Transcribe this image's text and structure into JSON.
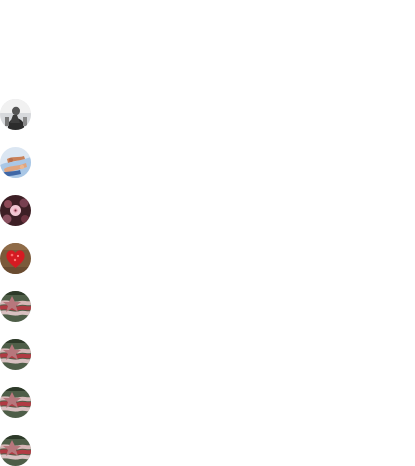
{
  "avatars": [
    {
      "label": "avatar-photo-dark-figure",
      "picture": "dark-figure"
    },
    {
      "label": "avatar-photo-hands",
      "picture": "hands"
    },
    {
      "label": "avatar-photo-pink-flower",
      "picture": "pink-flower"
    },
    {
      "label": "avatar-photo-red-heart",
      "picture": "red-heart"
    },
    {
      "label": "avatar-photo-flag",
      "picture": "flag"
    },
    {
      "label": "avatar-photo-flag",
      "picture": "flag"
    },
    {
      "label": "avatar-photo-flag",
      "picture": "flag"
    },
    {
      "label": "avatar-photo-flag",
      "picture": "flag"
    }
  ]
}
